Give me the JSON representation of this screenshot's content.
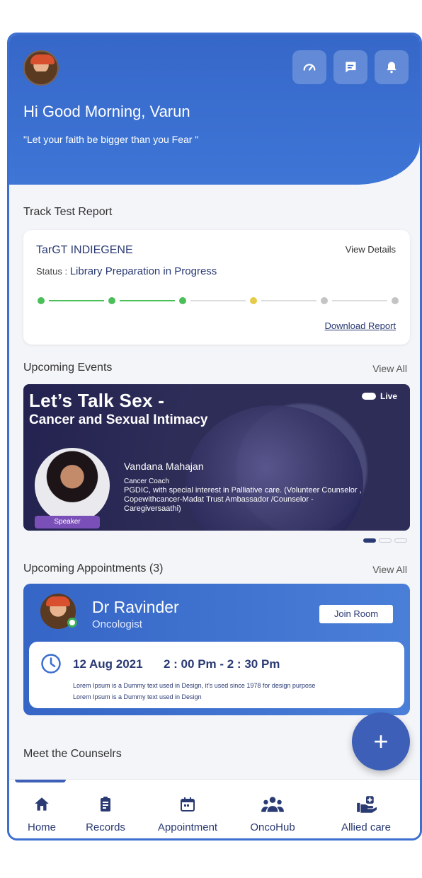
{
  "header": {
    "greeting": "Hi Good Morning, Varun",
    "quote": "\"Let your faith be bigger than you Fear \"",
    "icons": [
      "gauge-icon",
      "chat-icon",
      "bell-icon"
    ]
  },
  "track": {
    "section_title": "Track Test Report",
    "test_name": "TarGT INDIEGENE",
    "view_details": "View Details",
    "status_label": "Status :",
    "status_value": "Library Preparation in Progress",
    "steps_done": 3,
    "steps_current": 4,
    "steps_total": 6,
    "download": "Download Report",
    "colors": {
      "done": "#4cbf5a",
      "current": "#e6cb4a",
      "pending": "#c4c4c4"
    }
  },
  "events": {
    "section_title": "Upcoming Events",
    "view_all": "View All",
    "banner": {
      "title": "Let’s Talk Sex -",
      "subtitle": "Cancer and Sexual Intimacy",
      "live": "Live",
      "speaker_name": "Vandana Mahajan",
      "speaker_role": "Cancer Coach",
      "speaker_desc": "PGDIC, with special interest in Palliative care. (Volunteer Counselor , Copewithcancer-Madat Trust Ambassador /Counselor - Caregiversaathi)",
      "speaker_tag": "Speaker"
    },
    "pager_active": 1,
    "pager_total": 3
  },
  "appointments": {
    "section_title": "Upcoming Appointments (3)",
    "view_all": "View All",
    "doctor_name": "Dr Ravinder",
    "doctor_role": "Oncologist",
    "join": "Join Room",
    "date": "12 Aug 2021",
    "time": "2 : 00 Pm - 2 : 30 Pm",
    "desc_line1": "Lorem Ipsum is a Dummy text used in Design, it's used since 1978 for design purpose",
    "desc_line2": "Lorem Ipsum is a Dummy text used in Design"
  },
  "counselors": {
    "section_title": "Meet the Counselrs"
  },
  "fab": {
    "label": "+"
  },
  "tabs": [
    {
      "label": "Home",
      "icon": "home-icon"
    },
    {
      "label": "Records",
      "icon": "records-icon"
    },
    {
      "label": "Appointment",
      "icon": "calendar-icon"
    },
    {
      "label": "OncoHub",
      "icon": "community-icon"
    },
    {
      "label": "Allied care",
      "icon": "allied-care-icon"
    }
  ]
}
